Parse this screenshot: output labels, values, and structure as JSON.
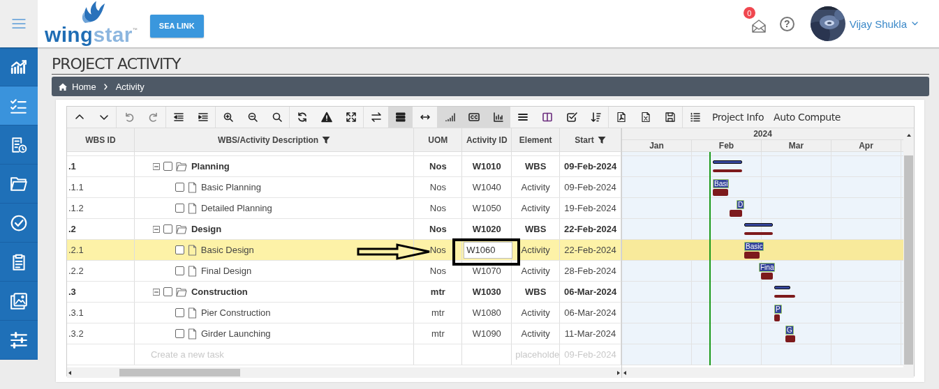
{
  "header": {
    "logo": "wingstar",
    "logo_mark": "™",
    "project_button": "SEA LINK",
    "notifications": "0",
    "help": "?",
    "user_name": "Vijay Shukla"
  },
  "sidebar": {
    "items": [
      {
        "selected": false
      },
      {
        "selected": true
      },
      {
        "selected": false
      },
      {
        "selected": false
      },
      {
        "selected": false
      },
      {
        "selected": false
      },
      {
        "selected": false
      },
      {
        "selected": false
      }
    ]
  },
  "page_title": "PROJECT ACTIVITY",
  "breadcrumb": [
    "Home",
    "Activity"
  ],
  "toolbar": {
    "groups": [
      [
        {
          "kind": "icon",
          "on": false
        },
        {
          "kind": "icon",
          "on": false
        }
      ],
      [
        {
          "kind": "icon",
          "on": false
        },
        {
          "kind": "icon",
          "on": false
        }
      ],
      [
        {
          "kind": "icon",
          "on": false
        },
        {
          "kind": "icon",
          "on": false
        }
      ],
      [
        {
          "kind": "icon",
          "on": false
        },
        {
          "kind": "icon",
          "on": false
        },
        {
          "kind": "icon",
          "on": false
        }
      ],
      [
        {
          "kind": "icon",
          "on": false
        },
        {
          "kind": "icon",
          "on": false
        },
        {
          "kind": "icon",
          "on": false
        }
      ],
      [
        {
          "kind": "icon",
          "on": false
        },
        {
          "kind": "icon",
          "on": true
        },
        {
          "kind": "icon",
          "on": false
        },
        {
          "kind": "icon",
          "on": true
        },
        {
          "kind": "icon",
          "on": true
        },
        {
          "kind": "icon",
          "on": true
        },
        {
          "kind": "icon",
          "on": false
        },
        {
          "kind": "icon",
          "on": false
        },
        {
          "kind": "icon",
          "on": false
        },
        {
          "kind": "icon",
          "on": false
        }
      ],
      [
        {
          "kind": "icon",
          "on": false
        },
        {
          "kind": "icon",
          "on": false
        },
        {
          "kind": "icon",
          "on": false
        }
      ],
      [
        {
          "kind": "icon",
          "on": false
        },
        {
          "kind": "text",
          "label": "Project Info"
        },
        {
          "kind": "text",
          "label": "Auto Compute"
        }
      ]
    ]
  },
  "table": {
    "columns": [
      {
        "label": "WBS ID",
        "filter": false
      },
      {
        "label": "WBS/Activity Description",
        "filter": true
      },
      {
        "label": "UOM",
        "filter": false
      },
      {
        "label": "Activity ID",
        "filter": false
      },
      {
        "label": "Element",
        "filter": false
      },
      {
        "label": "Start",
        "filter": true
      }
    ],
    "rows": [
      {
        "kind": "wbs",
        "wbs_id": ".1",
        "expanded": true,
        "checked": false,
        "description": "Planning",
        "uom": "Nos",
        "activity_id": "W1010",
        "element": "WBS",
        "start": "09-Feb-2024",
        "selected": false,
        "editing": false
      },
      {
        "kind": "activity",
        "wbs_id": ".1.1",
        "checked": false,
        "description": "Basic Planning",
        "uom": "Nos",
        "activity_id": "W1040",
        "element": "Activity",
        "start": "09-Feb-2024",
        "selected": false,
        "editing": false,
        "bar_label": "Basi"
      },
      {
        "kind": "activity",
        "wbs_id": ".1.2",
        "checked": false,
        "description": "Detailed Planning",
        "uom": "Nos",
        "activity_id": "W1050",
        "element": "Activity",
        "start": "19-Feb-2024",
        "selected": false,
        "editing": false,
        "bar_label": "D"
      },
      {
        "kind": "wbs",
        "wbs_id": ".2",
        "expanded": true,
        "checked": false,
        "description": "Design",
        "uom": "Nos",
        "activity_id": "W1020",
        "element": "WBS",
        "start": "22-Feb-2024",
        "selected": false,
        "editing": false
      },
      {
        "kind": "activity",
        "wbs_id": ".2.1",
        "checked": false,
        "description": "Basic Design",
        "uom": "Nos",
        "activity_id": "W1060",
        "element": "Activity",
        "start": "22-Feb-2024",
        "selected": true,
        "editing": true,
        "bar_label": "Basic"
      },
      {
        "kind": "activity",
        "wbs_id": ".2.2",
        "checked": false,
        "description": "Final Design",
        "uom": "Nos",
        "activity_id": "W1070",
        "element": "Activity",
        "start": "28-Feb-2024",
        "selected": false,
        "editing": false,
        "bar_label": "Fina"
      },
      {
        "kind": "wbs",
        "wbs_id": ".3",
        "expanded": true,
        "checked": false,
        "description": "Construction",
        "uom": "mtr",
        "activity_id": "W1030",
        "element": "WBS",
        "start": "06-Mar-2024",
        "selected": false,
        "editing": false
      },
      {
        "kind": "activity",
        "wbs_id": ".3.1",
        "checked": false,
        "description": "Pier Construction",
        "uom": "mtr",
        "activity_id": "W1080",
        "element": "Activity",
        "start": "06-Mar-2024",
        "selected": false,
        "editing": false,
        "bar_label": "P"
      },
      {
        "kind": "activity",
        "wbs_id": ".3.2",
        "checked": false,
        "description": "Girder Launching",
        "uom": "mtr",
        "activity_id": "W1090",
        "element": "Activity",
        "start": "11-Mar-2024",
        "selected": false,
        "editing": false,
        "bar_label": "G"
      }
    ],
    "new_task": {
      "placeholder": "Create a new task",
      "element_placeholder": "placeholde",
      "start": "09-Feb-2024"
    }
  },
  "gantt": {
    "year": "2024",
    "months": [
      "Jan",
      "Feb",
      "Mar",
      "Apr"
    ]
  }
}
